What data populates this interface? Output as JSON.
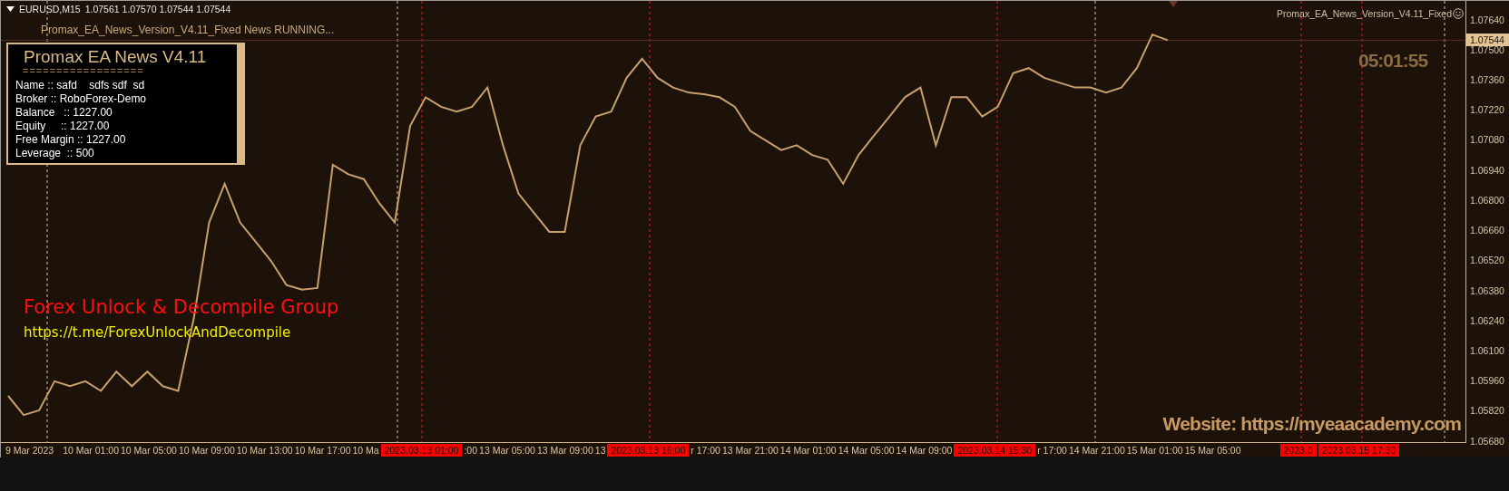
{
  "chart_header": {
    "symbol": "EURUSD,M15",
    "quotes": "1.07561 1.07570 1.07544 1.07544"
  },
  "ea_status": "Promax_EA_News_Version_V4.11_Fixed News RUNNING...",
  "ea_name_label": "Promax_EA_News_Version_V4.11_Fixed",
  "info_panel": {
    "title": "Promax EA News V4.11",
    "separator": "==================",
    "lines": [
      "Name :: safd    sdfs sdf  sd",
      "Broker :: RoboForex-Demo",
      "Balance   :: 1227.00",
      "Equity     :: 1227.00",
      "Free Margin :: 1227.00",
      "Leverage  :: 500"
    ]
  },
  "countdown": "05:01:55",
  "group_text": "Forex Unlock & Decompile Group",
  "group_link": "https://t.me/ForexUnlockAndDecompile",
  "website": "Website: https://myeaacademy.com",
  "price_axis": {
    "current_price": "1.07544"
  },
  "time_axis": {
    "labels": [
      "9 Mar 2023",
      "10 Mar 01:00",
      "10 Mar 05:00",
      "10 Mar 09:00",
      "10 Mar 13:00",
      "10 Mar 17:00",
      "10 Ma",
      ":00",
      "13 Mar 05:00",
      "13 Mar 09:00",
      "13",
      "r 17:00",
      "13 Mar 21:00",
      "14 Mar 01:00",
      "14 Mar 05:00",
      "14 Mar 09:00",
      "r 17:00",
      "14 Mar 21:00",
      "15 Mar 01:00",
      "15 Mar 05:00"
    ],
    "events": [
      "2023.03.13 01:00",
      "2023.03.13 16:00",
      "2023.03.14 15:30",
      "2023.0",
      "2023.03.15 17:30"
    ]
  },
  "chart_data": {
    "type": "line",
    "ref_lines": [
      {
        "axis": "y",
        "value": 1.07544,
        "color": "#5c2b22"
      }
    ],
    "ylim": [
      1.05674,
      1.07727
    ],
    "yticks": [
      {
        "value": 1.0764,
        "label": "1.07640"
      },
      {
        "value": 1.075,
        "label": "1.07500"
      },
      {
        "value": 1.0736,
        "label": "1.07360"
      },
      {
        "value": 1.0722,
        "label": "1.07220"
      },
      {
        "value": 1.0708,
        "label": "1.07080"
      },
      {
        "value": 1.0694,
        "label": "1.06940"
      },
      {
        "value": 1.068,
        "label": "1.06800"
      },
      {
        "value": 1.0666,
        "label": "1.06660"
      },
      {
        "value": 1.0652,
        "label": "1.06520"
      },
      {
        "value": 1.0638,
        "label": "1.06380"
      },
      {
        "value": 1.0624,
        "label": "1.06240"
      },
      {
        "value": 1.061,
        "label": "1.06100"
      },
      {
        "value": 1.0596,
        "label": "1.05960"
      },
      {
        "value": 1.0582,
        "label": "1.05820"
      },
      {
        "value": 1.0568,
        "label": "1.05680"
      }
    ],
    "series": [
      {
        "color": "#c8a06e",
        "values": [
          1.05889,
          1.058,
          1.05822,
          1.05957,
          1.05934,
          1.05957,
          1.05912,
          1.06002,
          1.05934,
          1.06002,
          1.05934,
          1.05912,
          1.06248,
          1.06696,
          1.06876,
          1.06696,
          1.06607,
          1.06517,
          1.06405,
          1.06383,
          1.06391,
          1.06965,
          1.0692,
          1.06898,
          1.06786,
          1.06696,
          1.07145,
          1.07279,
          1.07234,
          1.07212,
          1.07234,
          1.07324,
          1.07055,
          1.06831,
          1.06741,
          1.06652,
          1.06652,
          1.07055,
          1.07189,
          1.07212,
          1.07369,
          1.07458,
          1.07369,
          1.07324,
          1.07301,
          1.07293,
          1.07279,
          1.07234,
          1.07122,
          1.07077,
          1.07033,
          1.07055,
          1.0701,
          1.06988,
          1.06876,
          1.0701,
          1.071,
          1.07189,
          1.07279,
          1.07324,
          1.07055,
          1.07279,
          1.07279,
          1.07189,
          1.07234,
          1.07391,
          1.07414,
          1.07369,
          1.07346,
          1.07324,
          1.07324,
          1.07301,
          1.07324,
          1.07414,
          1.0757,
          1.07544
        ]
      }
    ]
  }
}
